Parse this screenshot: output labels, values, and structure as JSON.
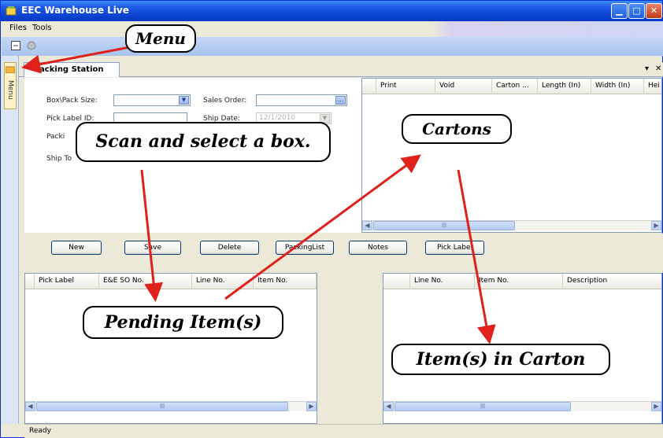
{
  "window": {
    "title": "EEC Warehouse Live"
  },
  "menu": {
    "files": "Files",
    "tools": "Tools"
  },
  "sidebar": {
    "tab_label": "Menu"
  },
  "tabs": [
    {
      "label": "Packing Station"
    }
  ],
  "tab_controls": {
    "pin": "▾",
    "close": "✕"
  },
  "form": {
    "box_pack_size_label": "Box\\Pack Size:",
    "sales_order_label": "Sales Order:",
    "pick_label_id_label": "Pick Label ID:",
    "ship_date_label": "Ship Date:",
    "ship_date_value": "12/1/2010",
    "packing_label_partial": "Packi",
    "ship_to_label_partial": "Ship To"
  },
  "cartons_grid": {
    "columns": [
      "Print",
      "Void",
      "Carton ...",
      "Length (In)",
      "Width (In)",
      "Hei"
    ]
  },
  "buttons": [
    "New",
    "Save",
    "Delete",
    "PackingList",
    "Notes",
    "Pick Label"
  ],
  "pending_grid": {
    "columns": [
      "Pick Label",
      "E&E SO No.",
      "Line No.",
      "Item No."
    ]
  },
  "carton_items_grid": {
    "columns": [
      "Line No.",
      "Item No.",
      "Description"
    ]
  },
  "status": {
    "text": "Ready"
  },
  "annotations": {
    "menu": "Menu",
    "scan": "Scan and select a box.",
    "cartons": "Cartons",
    "pending": "Pending Item(s)",
    "in_carton": "Item(s) in Carton"
  },
  "colors": {
    "titlebar": "#0a3fcf",
    "annotation_arrow": "#e0201a",
    "window_bg": "#ece9d8"
  }
}
